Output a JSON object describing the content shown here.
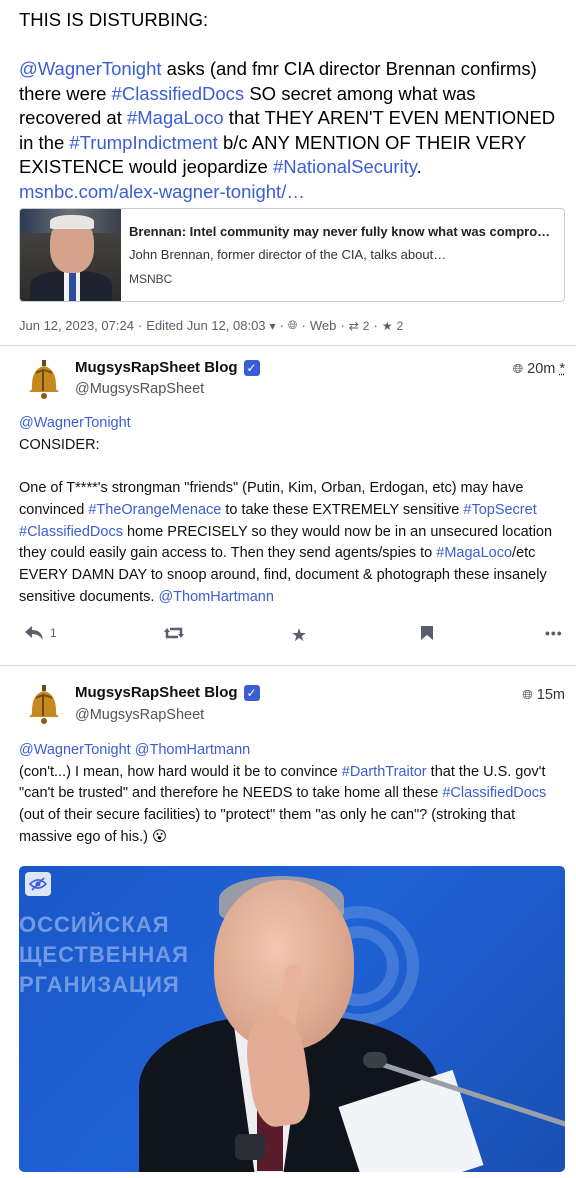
{
  "focused": {
    "line1": "THIS IS DISTURBING:",
    "mention": "@WagnerTonight",
    "t1": " asks (and fmr CIA director Brennan confirms) there were ",
    "tag1": "#ClassifiedDocs",
    "t2": " SO secret among what was recovered at ",
    "tag2": "#MagaLoco",
    "t3": " that THEY AREN'T EVEN MENTIONED in the ",
    "tag3": "#TrumpIndictment",
    "t4": " b/c ANY MENTION OF THEIR VERY EXISTENCE would jeopardize ",
    "tag4": "#NationalSecurity",
    "t5": ".",
    "link": "msnbc.com/alex-wagner-tonight/…"
  },
  "card": {
    "title": "Brennan: Intel community may never fully know what was compro…",
    "description": "John Brennan, former director of the CIA, talks about…",
    "source": "MSNBC"
  },
  "meta": {
    "date": "Jun 12, 2023, 07:24",
    "edited": "Edited Jun 12, 08:03",
    "visibility": "Web",
    "boosts": "2",
    "favourites": "2"
  },
  "reply1": {
    "display_name": "MugsysRapSheet Blog",
    "handle": "@MugsysRapSheet",
    "time": "20m",
    "time_suffix": "*",
    "mention": "@WagnerTonight",
    "line2": "CONSIDER:",
    "p_a": "One of T****'s strongman \"friends\" (Putin, Kim, Orban, Erdogan, etc) may have convinced ",
    "tag1": "#TheOrangeMenace",
    "p_b": " to take these EXTREMELY sensitive ",
    "tag2": "#TopSecret",
    "p_c": " ",
    "tag3": "#ClassifiedDocs",
    "p_d": " home PRECISELY so they would now be in an unsecured location they could easily gain access to. Then they send agents/spies to ",
    "tag4": "#MagaLoco",
    "p_e": "/etc EVERY DAMN DAY to snoop around, find, document & photograph these insanely sensitive documents. ",
    "mention2": "@ThomHartmann",
    "reply_count": "1"
  },
  "reply2": {
    "display_name": "MugsysRapSheet Blog",
    "handle": "@MugsysRapSheet",
    "time": "15m",
    "mention1": "@WagnerTonight",
    "mention2": "@ThomHartmann",
    "p_a": "(con't...) I mean, how hard would it be to convince ",
    "tag1": "#DarthTraitor",
    "p_b": " that the U.S. gov't \"can't be trusted\" and therefore he NEEDS to take home all these ",
    "tag2": "#ClassifiedDocs",
    "p_c": " (out of their secure facilities) to \"protect\" them \"as only he can\"? (stroking that massive ego of his.) ",
    "emoji": "😮"
  },
  "colors": {
    "link": "#3b5ed6",
    "accent": "#3b5ed6",
    "divider": "#d6d9e0"
  }
}
